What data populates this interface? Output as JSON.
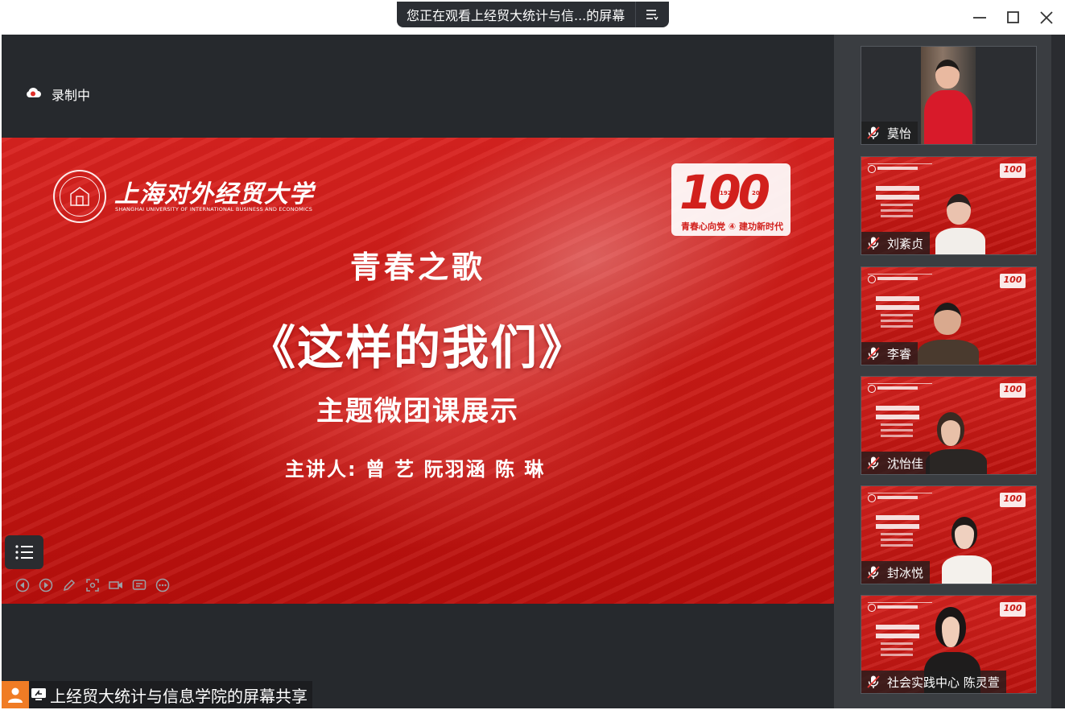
{
  "window": {
    "share_banner": "您正在观看上经贸大统计与信...的屏幕"
  },
  "stage": {
    "recording_label": "录制中",
    "share_label": "上经贸大统计与信息学院的屏幕共享"
  },
  "slide": {
    "school_name_cn": "上海对外经贸大学",
    "school_name_en": "SHANGHAI UNIVERSITY OF INTERNATIONAL BUSINESS AND ECONOMICS",
    "badge_number": "100",
    "badge_year_start": "1922",
    "badge_year_end": "2022",
    "badge_slogan": "青春心向党 ④ 建功新时代",
    "kicker": "青春之歌",
    "title": "《这样的我们》",
    "subtitle": "主题微团课展示",
    "speakers": "主讲人: 曾 艺   阮羽涵   陈 琳"
  },
  "participants": [
    {
      "name": "莫怡",
      "background": "video"
    },
    {
      "name": "刘紊贞",
      "background": "slide"
    },
    {
      "name": "李睿",
      "background": "slide"
    },
    {
      "name": "沈怡佳",
      "background": "slide"
    },
    {
      "name": "封冰悦",
      "background": "slide"
    },
    {
      "name": "社会实践中心 陈灵萱",
      "background": "slide"
    }
  ],
  "colors": {
    "slide_red": "#c81914",
    "chrome_dark": "#26292d",
    "sidebar": "#3a3d41",
    "accent_orange": "#f07c25"
  }
}
